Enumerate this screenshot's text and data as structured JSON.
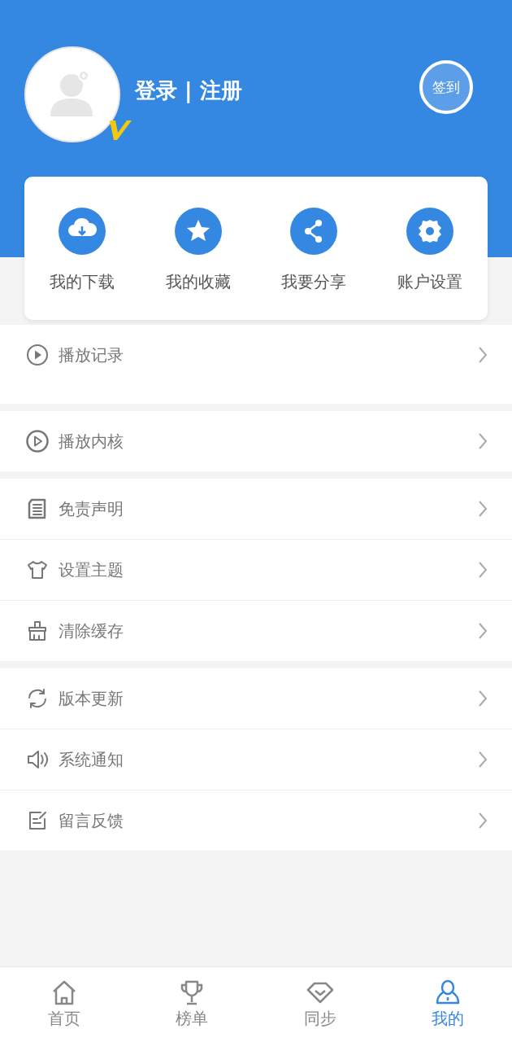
{
  "header": {
    "login_text": "登录 | 注册",
    "checkin_button": "签到"
  },
  "quick_actions": [
    {
      "label": "我的下载"
    },
    {
      "label": "我的收藏"
    },
    {
      "label": "我要分享"
    },
    {
      "label": "账户设置"
    }
  ],
  "menu_groups": [
    {
      "items": [
        {
          "label": "播放记录"
        }
      ]
    },
    {
      "items": [
        {
          "label": "播放内核"
        }
      ]
    },
    {
      "items": [
        {
          "label": "免责声明"
        },
        {
          "label": "设置主题"
        },
        {
          "label": "清除缓存"
        }
      ]
    },
    {
      "items": [
        {
          "label": "版本更新"
        },
        {
          "label": "系统通知"
        },
        {
          "label": "留言反馈"
        }
      ]
    }
  ],
  "tab_bar": [
    {
      "label": "首页",
      "selected": false
    },
    {
      "label": "榜单",
      "selected": false
    },
    {
      "label": "同步",
      "selected": false
    },
    {
      "label": "我的",
      "selected": true
    }
  ]
}
